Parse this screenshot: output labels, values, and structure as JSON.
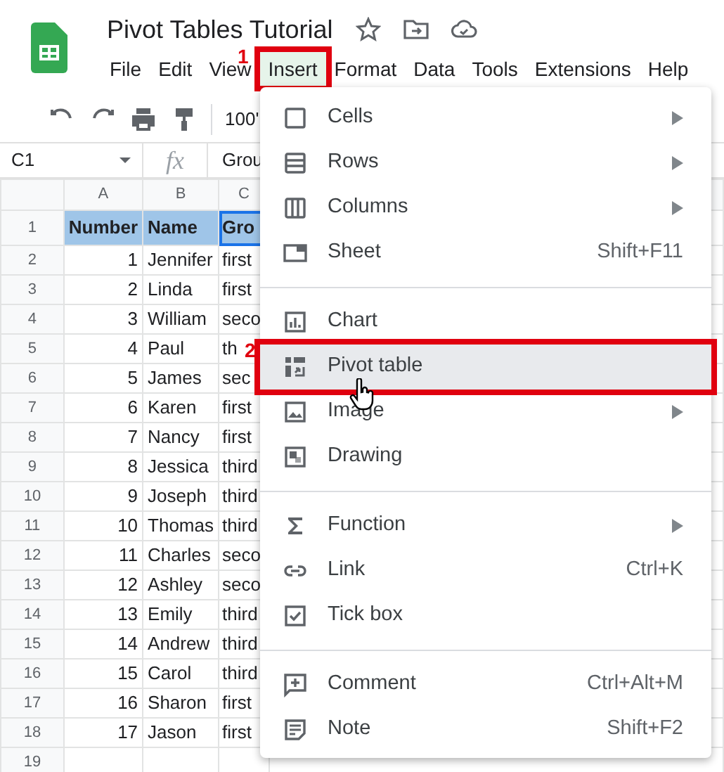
{
  "app": {
    "title": "Pivot Tables Tutorial"
  },
  "menu_bar": [
    {
      "label": "File",
      "selected": false
    },
    {
      "label": "Edit",
      "selected": false
    },
    {
      "label": "View",
      "selected": false
    },
    {
      "label": "Insert",
      "selected": true,
      "annotated": true
    },
    {
      "label": "Format",
      "selected": false
    },
    {
      "label": "Data",
      "selected": false
    },
    {
      "label": "Tools",
      "selected": false
    },
    {
      "label": "Extensions",
      "selected": false
    },
    {
      "label": "Help",
      "selected": false
    }
  ],
  "toolbar": {
    "zoom": "100'"
  },
  "formula_bar": {
    "cell_ref": "C1",
    "fx": "fx",
    "content": "Grou"
  },
  "sheet": {
    "columns": [
      "A",
      "B",
      "C"
    ],
    "rows": [
      {
        "number": "1",
        "kind": "header",
        "cells": [
          "Number",
          "Name",
          "Gro"
        ]
      },
      {
        "number": "2",
        "kind": "data",
        "cells": [
          "1",
          "Jennifer",
          "first"
        ]
      },
      {
        "number": "3",
        "kind": "data",
        "cells": [
          "2",
          "Linda",
          "first"
        ]
      },
      {
        "number": "4",
        "kind": "data",
        "cells": [
          "3",
          "William",
          "seco"
        ]
      },
      {
        "number": "5",
        "kind": "data",
        "cells": [
          "4",
          "Paul",
          "th"
        ]
      },
      {
        "number": "6",
        "kind": "data",
        "cells": [
          "5",
          "James",
          "sec"
        ]
      },
      {
        "number": "7",
        "kind": "data",
        "cells": [
          "6",
          "Karen",
          "first"
        ]
      },
      {
        "number": "8",
        "kind": "data",
        "cells": [
          "7",
          "Nancy",
          "first"
        ]
      },
      {
        "number": "9",
        "kind": "data",
        "cells": [
          "8",
          "Jessica",
          "third"
        ]
      },
      {
        "number": "10",
        "kind": "data",
        "cells": [
          "9",
          "Joseph",
          "third"
        ]
      },
      {
        "number": "11",
        "kind": "data",
        "cells": [
          "10",
          "Thomas",
          "third"
        ]
      },
      {
        "number": "12",
        "kind": "data",
        "cells": [
          "11",
          "Charles",
          "seco"
        ]
      },
      {
        "number": "13",
        "kind": "data",
        "cells": [
          "12",
          "Ashley",
          "seco"
        ]
      },
      {
        "number": "14",
        "kind": "data",
        "cells": [
          "13",
          "Emily",
          "third"
        ]
      },
      {
        "number": "15",
        "kind": "data",
        "cells": [
          "14",
          "Andrew",
          "third"
        ]
      },
      {
        "number": "16",
        "kind": "data",
        "cells": [
          "15",
          "Carol",
          "third"
        ]
      },
      {
        "number": "17",
        "kind": "data",
        "cells": [
          "16",
          "Sharon",
          "first"
        ]
      },
      {
        "number": "18",
        "kind": "data",
        "cells": [
          "17",
          "Jason",
          "first"
        ]
      },
      {
        "number": "19",
        "kind": "data",
        "cells": [
          "",
          "",
          ""
        ]
      }
    ]
  },
  "insert_menu": {
    "items": [
      {
        "kind": "item",
        "label": "Cells",
        "submenu": true,
        "hovered": false
      },
      {
        "kind": "item",
        "label": "Rows",
        "submenu": true,
        "hovered": false
      },
      {
        "kind": "item",
        "label": "Columns",
        "submenu": true,
        "hovered": false
      },
      {
        "kind": "item",
        "label": "Sheet",
        "shortcut": "Shift+F11",
        "submenu": false,
        "hovered": false
      },
      {
        "kind": "divider"
      },
      {
        "kind": "item",
        "label": "Chart",
        "submenu": false,
        "hovered": false
      },
      {
        "kind": "item",
        "label": "Pivot table",
        "submenu": false,
        "hovered": true,
        "annotated": true
      },
      {
        "kind": "item",
        "label": "Image",
        "submenu": true,
        "hovered": false
      },
      {
        "kind": "item",
        "label": "Drawing",
        "submenu": false,
        "hovered": false
      },
      {
        "kind": "divider"
      },
      {
        "kind": "item",
        "label": "Function",
        "submenu": true,
        "hovered": false
      },
      {
        "kind": "item",
        "label": "Link",
        "shortcut": "Ctrl+K",
        "submenu": false,
        "hovered": false
      },
      {
        "kind": "item",
        "label": "Tick box",
        "submenu": false,
        "hovered": false
      },
      {
        "kind": "divider"
      },
      {
        "kind": "item",
        "label": "Comment",
        "shortcut": "Ctrl+Alt+M",
        "submenu": false,
        "hovered": false
      },
      {
        "kind": "item",
        "label": "Note",
        "shortcut": "Shift+F2",
        "submenu": false,
        "hovered": false
      }
    ]
  },
  "annotations": [
    {
      "label": "1"
    },
    {
      "label": "2"
    }
  ]
}
